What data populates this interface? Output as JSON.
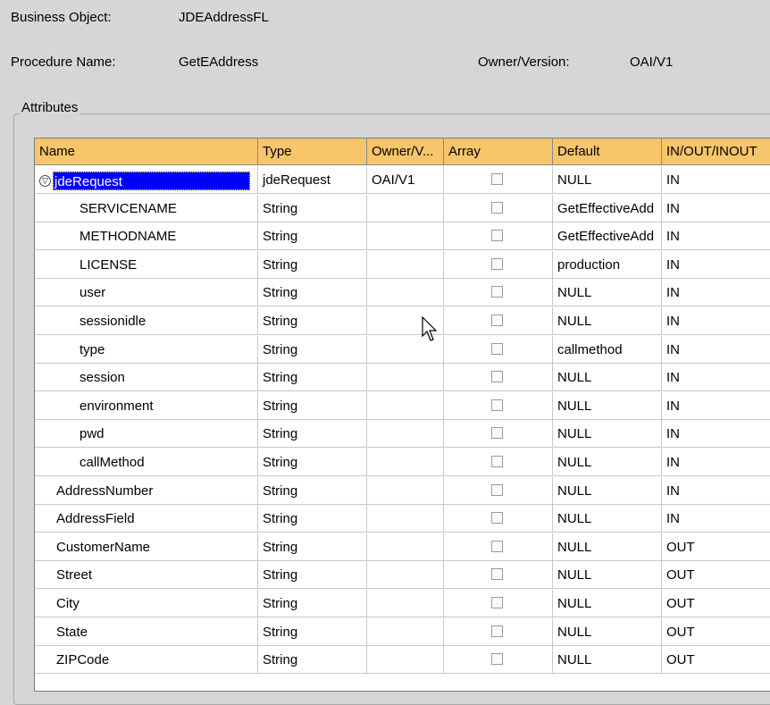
{
  "header": {
    "business_object_label": "Business Object:",
    "business_object_value": "JDEAddressFL",
    "procedure_name_label": "Procedure Name:",
    "procedure_name_value": "GetEAddress",
    "owner_version_label": "Owner/Version:",
    "owner_version_value": "OAI/V1"
  },
  "attributes": {
    "group_title": "Attributes",
    "columns": [
      "Name",
      "Type",
      "Owner/V...",
      "Array",
      "Default",
      "IN/OUT/INOUT"
    ],
    "rows": [
      {
        "name": "jdeRequest",
        "type": "jdeRequest",
        "owner": "OAI/V1",
        "default": "NULL",
        "io": "IN",
        "level": 0
      },
      {
        "name": "SERVICENAME",
        "type": "String",
        "owner": "",
        "default": "GetEffectiveAdd",
        "io": "IN",
        "level": 2
      },
      {
        "name": "METHODNAME",
        "type": "String",
        "owner": "",
        "default": "GetEffectiveAdd",
        "io": "IN",
        "level": 2
      },
      {
        "name": "LICENSE",
        "type": "String",
        "owner": "",
        "default": "production",
        "io": "IN",
        "level": 2
      },
      {
        "name": "user",
        "type": "String",
        "owner": "",
        "default": "NULL",
        "io": "IN",
        "level": 2
      },
      {
        "name": "sessionidle",
        "type": "String",
        "owner": "",
        "default": "NULL",
        "io": "IN",
        "level": 2
      },
      {
        "name": "type",
        "type": "String",
        "owner": "",
        "default": "callmethod",
        "io": "IN",
        "level": 2
      },
      {
        "name": "session",
        "type": "String",
        "owner": "",
        "default": "NULL",
        "io": "IN",
        "level": 2
      },
      {
        "name": "environment",
        "type": "String",
        "owner": "",
        "default": "NULL",
        "io": "IN",
        "level": 2
      },
      {
        "name": "pwd",
        "type": "String",
        "owner": "",
        "default": "NULL",
        "io": "IN",
        "level": 2
      },
      {
        "name": "callMethod",
        "type": "String",
        "owner": "",
        "default": "NULL",
        "io": "IN",
        "level": 2
      },
      {
        "name": "AddressNumber",
        "type": "String",
        "owner": "",
        "default": "NULL",
        "io": "IN",
        "level": 1
      },
      {
        "name": "AddressField",
        "type": "String",
        "owner": "",
        "default": "NULL",
        "io": "IN",
        "level": 1
      },
      {
        "name": "CustomerName",
        "type": "String",
        "owner": "",
        "default": "NULL",
        "io": "OUT",
        "level": 1
      },
      {
        "name": "Street",
        "type": "String",
        "owner": "",
        "default": "NULL",
        "io": "OUT",
        "level": 1
      },
      {
        "name": "City",
        "type": "String",
        "owner": "",
        "default": "NULL",
        "io": "OUT",
        "level": 1
      },
      {
        "name": "State",
        "type": "String",
        "owner": "",
        "default": "NULL",
        "io": "OUT",
        "level": 1
      },
      {
        "name": "ZIPCode",
        "type": "String",
        "owner": "",
        "default": "NULL",
        "io": "OUT",
        "level": 1
      }
    ]
  },
  "icons": {
    "tree_toggle": "collapse-icon",
    "cursor": "mouse-pointer-icon"
  },
  "colors": {
    "header_bg": "#f7c56a",
    "selection_bg": "#0000ff",
    "window_bg": "#d6d6d6"
  }
}
